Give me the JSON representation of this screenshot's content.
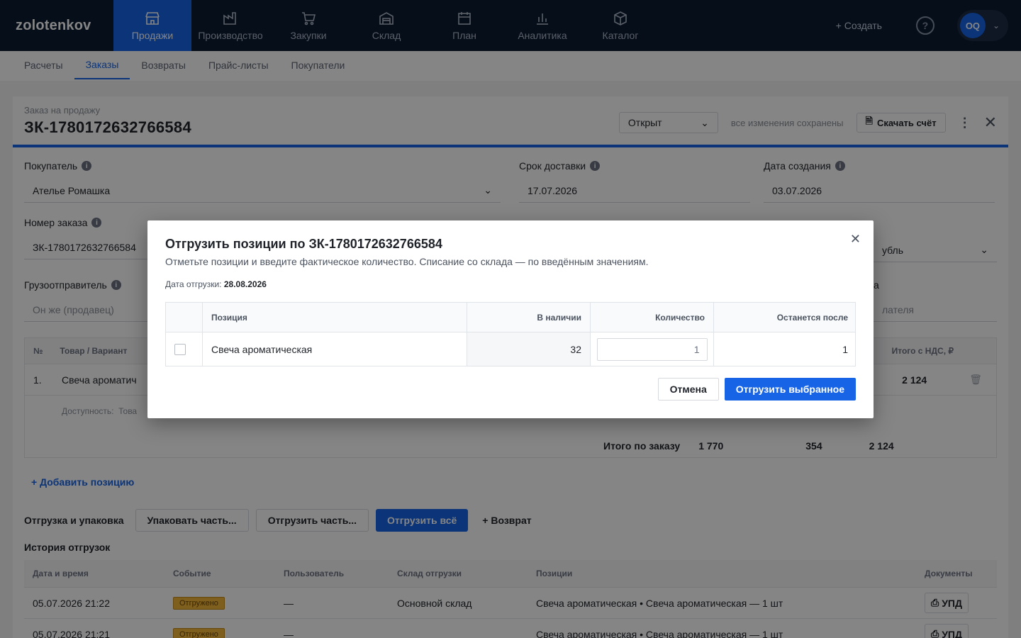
{
  "brand": "zolotenkov",
  "nav": {
    "items": [
      {
        "label": "Продажи",
        "icon": "store-icon"
      },
      {
        "label": "Производство",
        "icon": "factory-icon"
      },
      {
        "label": "Закупки",
        "icon": "cart-icon"
      },
      {
        "label": "Склад",
        "icon": "warehouse-icon"
      },
      {
        "label": "План",
        "icon": "calendar-icon"
      },
      {
        "label": "Аналитика",
        "icon": "chart-icon"
      },
      {
        "label": "Каталог",
        "icon": "box-icon"
      }
    ],
    "create_label": "+ Создать",
    "help": "?",
    "avatar": "OQ"
  },
  "subtabs": [
    "Расчеты",
    "Заказы",
    "Возвраты",
    "Прайс-листы",
    "Покупатели"
  ],
  "order": {
    "kicker": "Заказ на продажу",
    "title": "ЗК-1780172632766584",
    "status": "Открыт",
    "saved": "все изменения сохранены",
    "download": "Скачать счёт"
  },
  "fields": {
    "buyer_label": "Покупатель",
    "buyer_value": "Ателье Ромашка",
    "delivery_label": "Срок доставки",
    "delivery_value": "17.07.2026",
    "created_label": "Дата создания",
    "created_value": "03.07.2026",
    "order_no_label": "Номер заказа",
    "order_no_value": "ЗК-1780172632766584",
    "currency_value": "убль",
    "shipper_label": "Грузоотправитель",
    "shipper_value": "Он же (продавец)",
    "payer_value": "лателя",
    "payer_label": "а"
  },
  "items": {
    "col_no": "№",
    "col_product": "Товар / Вариант",
    "col_total_vat": "Итого с НДС, ₽",
    "row_no": "1.",
    "row_product": "Свеча ароматич",
    "row_total": "2 124",
    "availability": "Доступность:",
    "availability_val": "Това",
    "total_label": "Итого по заказу",
    "total_sum": "1 770",
    "total_vat": "354",
    "total_all": "2 124"
  },
  "add_position": "+ Добавить позицию",
  "shipping": {
    "title": "Отгрузка и упаковка",
    "pack_part": "Упаковать часть...",
    "ship_part": "Отгрузить часть...",
    "ship_all": "Отгрузить всё",
    "return": "+ Возврат"
  },
  "history": {
    "title": "История отгрузок",
    "columns": [
      "Дата и время",
      "Событие",
      "Пользователь",
      "Склад отгрузки",
      "Позиции",
      "Документы"
    ],
    "rows": [
      {
        "date": "05.07.2026 21:22",
        "event": "Отгружено",
        "user": "—",
        "warehouse": "Основной склад",
        "positions": "Свеча ароматическая • Свеча ароматическая — 1 шт",
        "doc": "УПД"
      },
      {
        "date": "05.07.2026 21:21",
        "event": "Отгружено",
        "user": "—",
        "warehouse": "",
        "positions": "Свеча ароматическая • Свеча ароматическая — 1 шт",
        "doc": "УПД"
      }
    ]
  },
  "modal": {
    "title": "Отгрузить позиции по ЗК-1780172632766584",
    "subtitle": "Отметьте позиции и введите фактическое количество. Списание со склада — по введённым значениям.",
    "date_label": "Дата отгрузки:",
    "date_value": "28.08.2026",
    "columns": {
      "position": "Позиция",
      "stock": "В наличии",
      "qty": "Количество",
      "remain": "Останется после"
    },
    "row": {
      "position": "Свеча ароматическая",
      "stock": "32",
      "qty": "1",
      "remain": "1"
    },
    "cancel": "Отмена",
    "confirm": "Отгрузить выбранное"
  },
  "colors": {
    "accent": "#1765e6",
    "nav_bg": "#0d1b33",
    "badge": "#f3b73a"
  }
}
